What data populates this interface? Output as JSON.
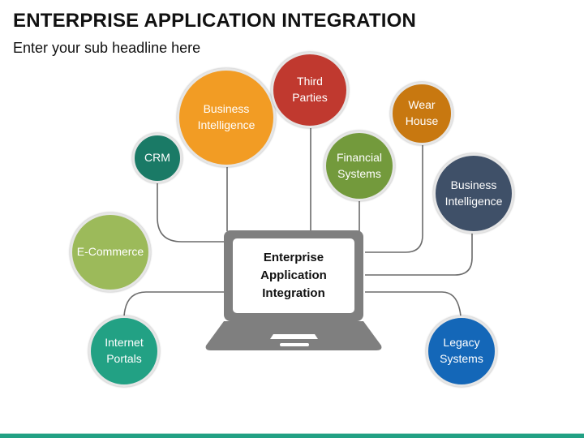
{
  "header": {
    "title": "ENTERPRISE APPLICATION INTEGRATION",
    "subtitle": "Enter your sub headline here"
  },
  "center": {
    "label": "Enterprise\nApplication\nIntegration",
    "icon": "laptop-icon",
    "color": "#7f7f7f"
  },
  "nodes": [
    {
      "id": "crm",
      "label": "CRM",
      "color": "#1a7a66",
      "connected": true
    },
    {
      "id": "business-intelligence-orange",
      "label": "Business\nIntelligence",
      "color": "#f29c24",
      "connected": true
    },
    {
      "id": "third-parties",
      "label": "Third\nParties",
      "color": "#c0392f",
      "connected": true
    },
    {
      "id": "financial-systems",
      "label": "Financial\nSystems",
      "color": "#739a3c",
      "connected": true
    },
    {
      "id": "wear-house",
      "label": "Wear\nHouse",
      "color": "#c87810",
      "connected": true
    },
    {
      "id": "business-intelligence-navy",
      "label": "Business\nIntelligence",
      "color": "#3f5068",
      "connected": true
    },
    {
      "id": "e-commerce",
      "label": "E-Commerce",
      "color": "#9cba5a",
      "connected": false
    },
    {
      "id": "internet-portals",
      "label": "Internet\nPortals",
      "color": "#22a184",
      "connected": true
    },
    {
      "id": "legacy-systems",
      "label": "Legacy\nSystems",
      "color": "#1467b8",
      "connected": true
    }
  ],
  "theme": {
    "connector_color": "#6b6b6b",
    "footer_color": "#22a184"
  }
}
